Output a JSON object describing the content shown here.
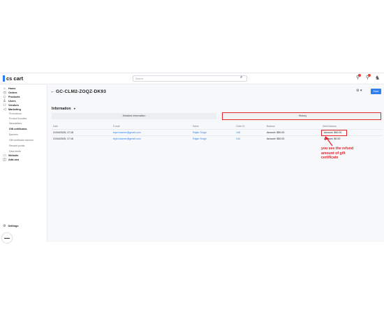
{
  "brand": {
    "logo_text": "cs cart"
  },
  "search": {
    "placeholder": "Search"
  },
  "sidebar": {
    "items": [
      {
        "label": "Home",
        "icon": "home-icon",
        "glyph": "⌂"
      },
      {
        "label": "Orders",
        "icon": "orders-icon",
        "glyph": "◷"
      },
      {
        "label": "Products",
        "icon": "tag-icon",
        "glyph": "◇"
      },
      {
        "label": "Users",
        "icon": "user-icon",
        "glyph": "♙"
      },
      {
        "label": "Vendors",
        "icon": "vendors-icon",
        "glyph": "⚇"
      },
      {
        "label": "Marketing",
        "icon": "megaphone-icon",
        "glyph": "◁"
      }
    ],
    "marketing_sub": [
      {
        "label": "Promotions"
      },
      {
        "label": "Product bundles"
      },
      {
        "label": "Newsletters"
      },
      {
        "label": "Gift certificates",
        "active": true
      },
      {
        "label": "Banners"
      },
      {
        "label": "Gift certificate banners"
      },
      {
        "label": "Reward points"
      },
      {
        "label": "Data feeds"
      }
    ],
    "items_after": [
      {
        "label": "Website",
        "icon": "monitor-icon",
        "glyph": "▭"
      },
      {
        "label": "Add-ons",
        "icon": "addons-icon",
        "glyph": "◫"
      }
    ],
    "settings_label": "Settings"
  },
  "page": {
    "title": "GC-CLM2-ZOQZ-DK93",
    "save_label": "Save",
    "section_title": "Information",
    "tabs": [
      {
        "label": "Detailed information"
      },
      {
        "label": "History"
      }
    ]
  },
  "table": {
    "headers": [
      "Date",
      "E-mail",
      "Name",
      "Order ID",
      "Balance",
      "Debit balance"
    ],
    "rows": [
      {
        "date": "21/04/2025, 17:16",
        "email": "tejal.ecamer@gmail.com",
        "name": "Rajan Singh",
        "order_id": "145",
        "balance": "Amount: $50.00",
        "debit": "Amount: $50.00"
      },
      {
        "date": "21/04/2025, 17:16",
        "email": "tejal.ecamer@gmail.com",
        "name": "Rajan Singh",
        "order_id": "144",
        "balance": "Amount: $50.00",
        "debit": "Amount: $0.00"
      }
    ]
  },
  "annotation": {
    "text": "you see the refund amount of gift certificate",
    "color": "#e3242b"
  },
  "colors": {
    "accent": "#2f80ed",
    "highlight": "#e3242b"
  }
}
